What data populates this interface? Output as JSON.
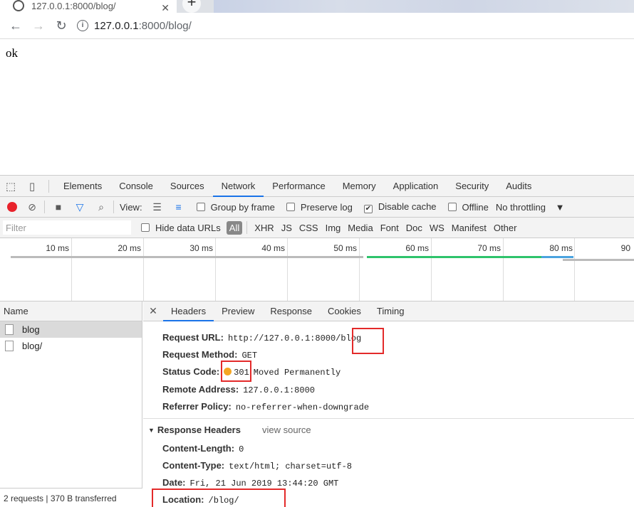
{
  "browser": {
    "tab_title": "127.0.0.1:8000/blog/",
    "url_host": "127.0.0.1",
    "url_path": ":8000/blog/"
  },
  "page": {
    "body_text": "ok"
  },
  "devtools": {
    "tabs": [
      "Elements",
      "Console",
      "Sources",
      "Network",
      "Performance",
      "Memory",
      "Application",
      "Security",
      "Audits"
    ],
    "active_tab": "Network",
    "toolbar": {
      "view_label": "View:",
      "group_by_frame": "Group by frame",
      "preserve_log": "Preserve log",
      "disable_cache": "Disable cache",
      "offline": "Offline",
      "throttling": "No throttling"
    },
    "filter": {
      "placeholder": "Filter",
      "hide_data_urls": "Hide data URLs",
      "types": [
        "All",
        "XHR",
        "JS",
        "CSS",
        "Img",
        "Media",
        "Font",
        "Doc",
        "WS",
        "Manifest",
        "Other"
      ]
    },
    "timeline_ticks": [
      "10 ms",
      "20 ms",
      "30 ms",
      "40 ms",
      "50 ms",
      "60 ms",
      "70 ms",
      "80 ms",
      "90"
    ],
    "requests": {
      "header": "Name",
      "rows": [
        "blog",
        "blog/"
      ],
      "status": "2 requests | 370 B transferred"
    },
    "details": {
      "tabs": [
        "Headers",
        "Preview",
        "Response",
        "Cookies",
        "Timing"
      ],
      "general": {
        "request_url_key": "Request URL:",
        "request_url": "http://127.0.0.1:8000/blog",
        "method_key": "Request Method:",
        "method": "GET",
        "status_key": "Status Code:",
        "status_code": "301",
        "status_text": "Moved Permanently",
        "remote_key": "Remote Address:",
        "remote": "127.0.0.1:8000",
        "referrer_key": "Referrer Policy:",
        "referrer": "no-referrer-when-downgrade"
      },
      "response_headers_title": "Response Headers",
      "view_source": "view source",
      "response_headers": {
        "content_length_key": "Content-Length:",
        "content_length": "0",
        "content_type_key": "Content-Type:",
        "content_type": "text/html; charset=utf-8",
        "date_key": "Date:",
        "date": "Fri, 21 Jun 2019 13:44:20 GMT",
        "location_key": "Location:",
        "location": "/blog/"
      }
    }
  },
  "colors": {
    "accent": "#1a73e8",
    "record": "#e8222b",
    "highlight": "#e32a2a",
    "status_dot": "#f5a623"
  }
}
